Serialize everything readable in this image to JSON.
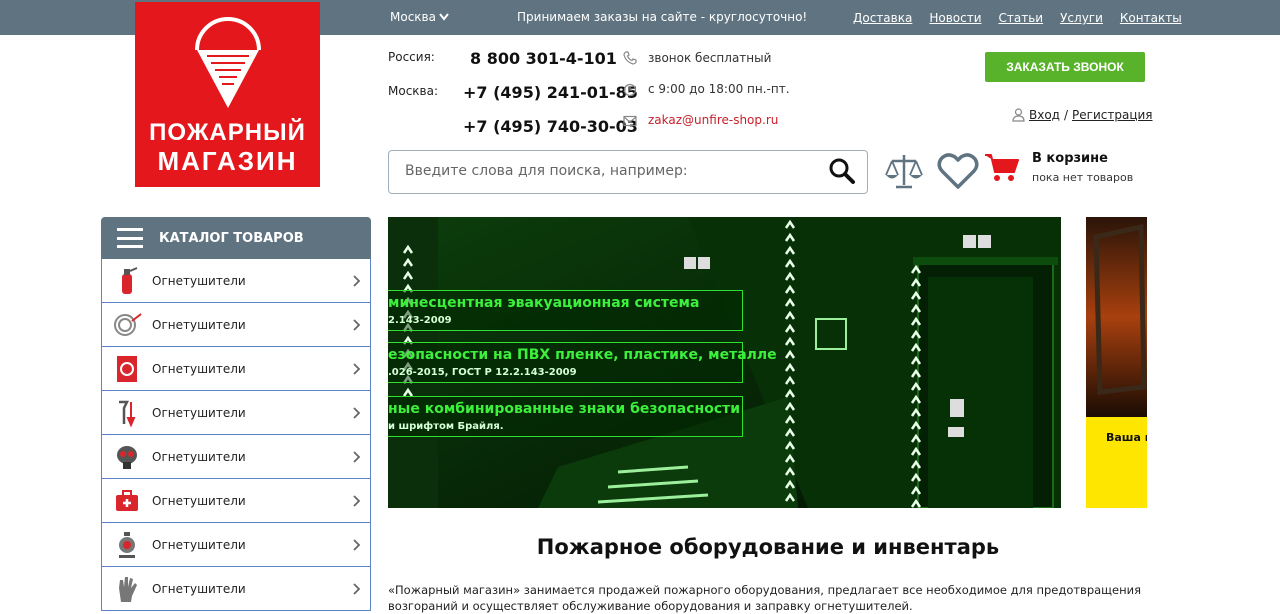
{
  "topbar": {
    "city": "Москва",
    "slogan": "Принимаем заказы на сайте - круглосуточно!",
    "nav": [
      "Доставка",
      "Новости",
      "Статьи",
      "Услуги",
      "Контакты"
    ]
  },
  "logo": {
    "line1": "ПОЖАРНЫЙ",
    "line2": "МАГАЗИН"
  },
  "contacts": {
    "russia_label": "Россия:",
    "russia_phone": "8  800  301-4-101",
    "moscow_label": "Москва:",
    "moscow_phone1": "+7 (495) 241-01-85",
    "moscow_phone2": "+7 (495) 740-30-03",
    "free_call": "звонок бесплатный",
    "hours": "с 9:00 до 18:00 пн.-пт.",
    "email": "zakaz@unfire-shop.ru"
  },
  "call_button": "ЗАКАЗАТЬ ЗВОНОК",
  "auth": {
    "login": "Вход",
    "sep": "/",
    "register": "Регистрация"
  },
  "search": {
    "placeholder": "Введите слова для поиска, например:"
  },
  "cart": {
    "title": "В корзине",
    "status": "пока нет товаров"
  },
  "catalog": {
    "title": "КАТАЛОГ ТОВАРОВ",
    "items": [
      {
        "label": "Огнетушители",
        "icon": "fire-extinguisher-icon"
      },
      {
        "label": "Огнетушители",
        "icon": "fire-hose-icon"
      },
      {
        "label": "Огнетушители",
        "icon": "fire-cabinet-icon"
      },
      {
        "label": "Огнетушители",
        "icon": "fire-tools-icon"
      },
      {
        "label": "Огнетушители",
        "icon": "gas-mask-icon"
      },
      {
        "label": "Огнетушители",
        "icon": "first-aid-kit-icon"
      },
      {
        "label": "Огнетушители",
        "icon": "fire-alarm-icon"
      },
      {
        "label": "Огнетушители",
        "icon": "protective-glove-icon"
      }
    ]
  },
  "banner": {
    "promos": [
      {
        "line1": "минесцентная эвакуационная система",
        "line2": "2.143-2009"
      },
      {
        "line1": "езопасности на ПВХ пленке, пластике, металле",
        "line2": ".026-2015, ГОСТ Р 12.2.143-2009"
      },
      {
        "line1": "ные комбинированные знаки безопасности",
        "line2": "и шрифтом Брайля."
      }
    ],
    "side_text": "Ваша н"
  },
  "content": {
    "heading": "Пожарное оборудование и инвентарь",
    "intro": "«Пожарный магазин» занимается продажей пожарного оборудования, предлагает все необходимое для предотвращения возгораний и осуществляет обслуживание оборудования и заправку огнетушителей."
  },
  "colors": {
    "topbar": "#5f7380",
    "brand_red": "#e3171c",
    "accent_green": "#58b32b",
    "banner_green": "#2fe02f"
  }
}
